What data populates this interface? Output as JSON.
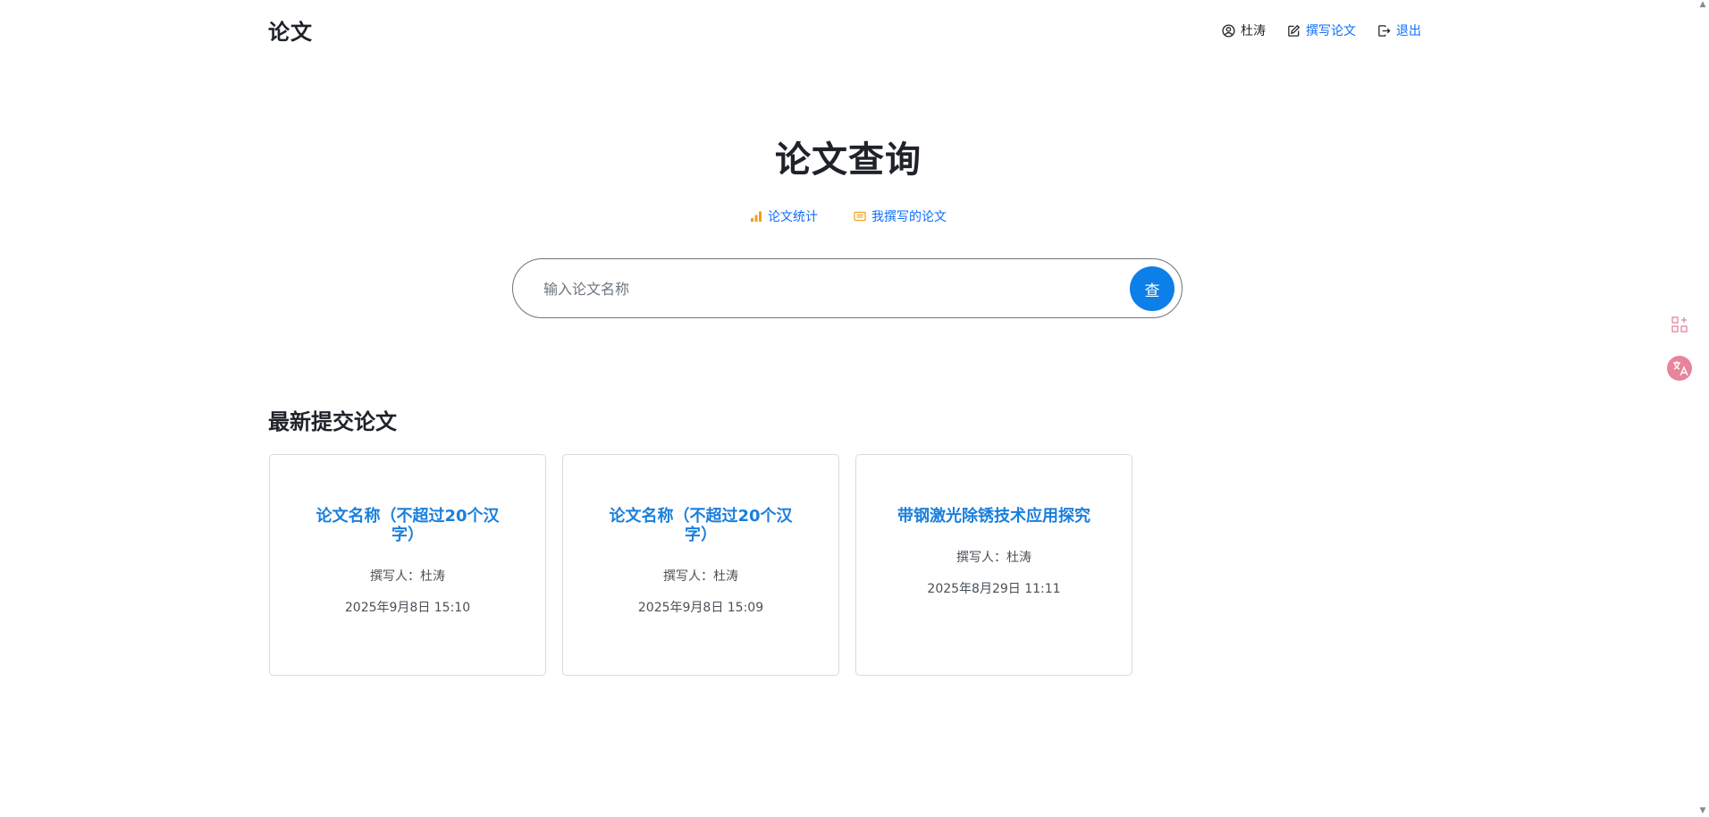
{
  "header": {
    "brand": "论文",
    "nav": {
      "user_name": "杜涛",
      "write_label": "撰写论文",
      "logout_label": "退出"
    }
  },
  "hero": {
    "title": "论文查询",
    "links": {
      "stats_label": "论文统计",
      "mine_label": "我撰写的论文"
    },
    "search": {
      "placeholder": "输入论文名称",
      "value": "",
      "button_label": "查"
    }
  },
  "latest": {
    "title": "最新提交论文",
    "papers": [
      {
        "title": "论文名称（不超过20个汉字）",
        "author": "撰写人：杜涛",
        "date": "2025年9月8日 15:10"
      },
      {
        "title": "论文名称（不超过20个汉字）",
        "author": "撰写人：杜涛",
        "date": "2025年9月8日 15:09"
      },
      {
        "title": "带钢激光除锈技术应用探究",
        "author": "撰写人：杜涛",
        "date": "2025年8月29日 11:11"
      }
    ]
  },
  "icons": {
    "user": "person-circle-icon",
    "write": "pencil-square-icon",
    "logout": "box-arrow-right-icon",
    "stats": "bar-chart-icon",
    "mine": "card-text-icon",
    "widget_apps": "apps-add-icon",
    "widget_translate": "translate-icon"
  },
  "colors": {
    "link": "#0d6efd",
    "accent_button": "#0d7fe8",
    "card_title": "#1a7fdc",
    "stats_icon": "#f0a020",
    "widget_pink": "#e8849c"
  }
}
